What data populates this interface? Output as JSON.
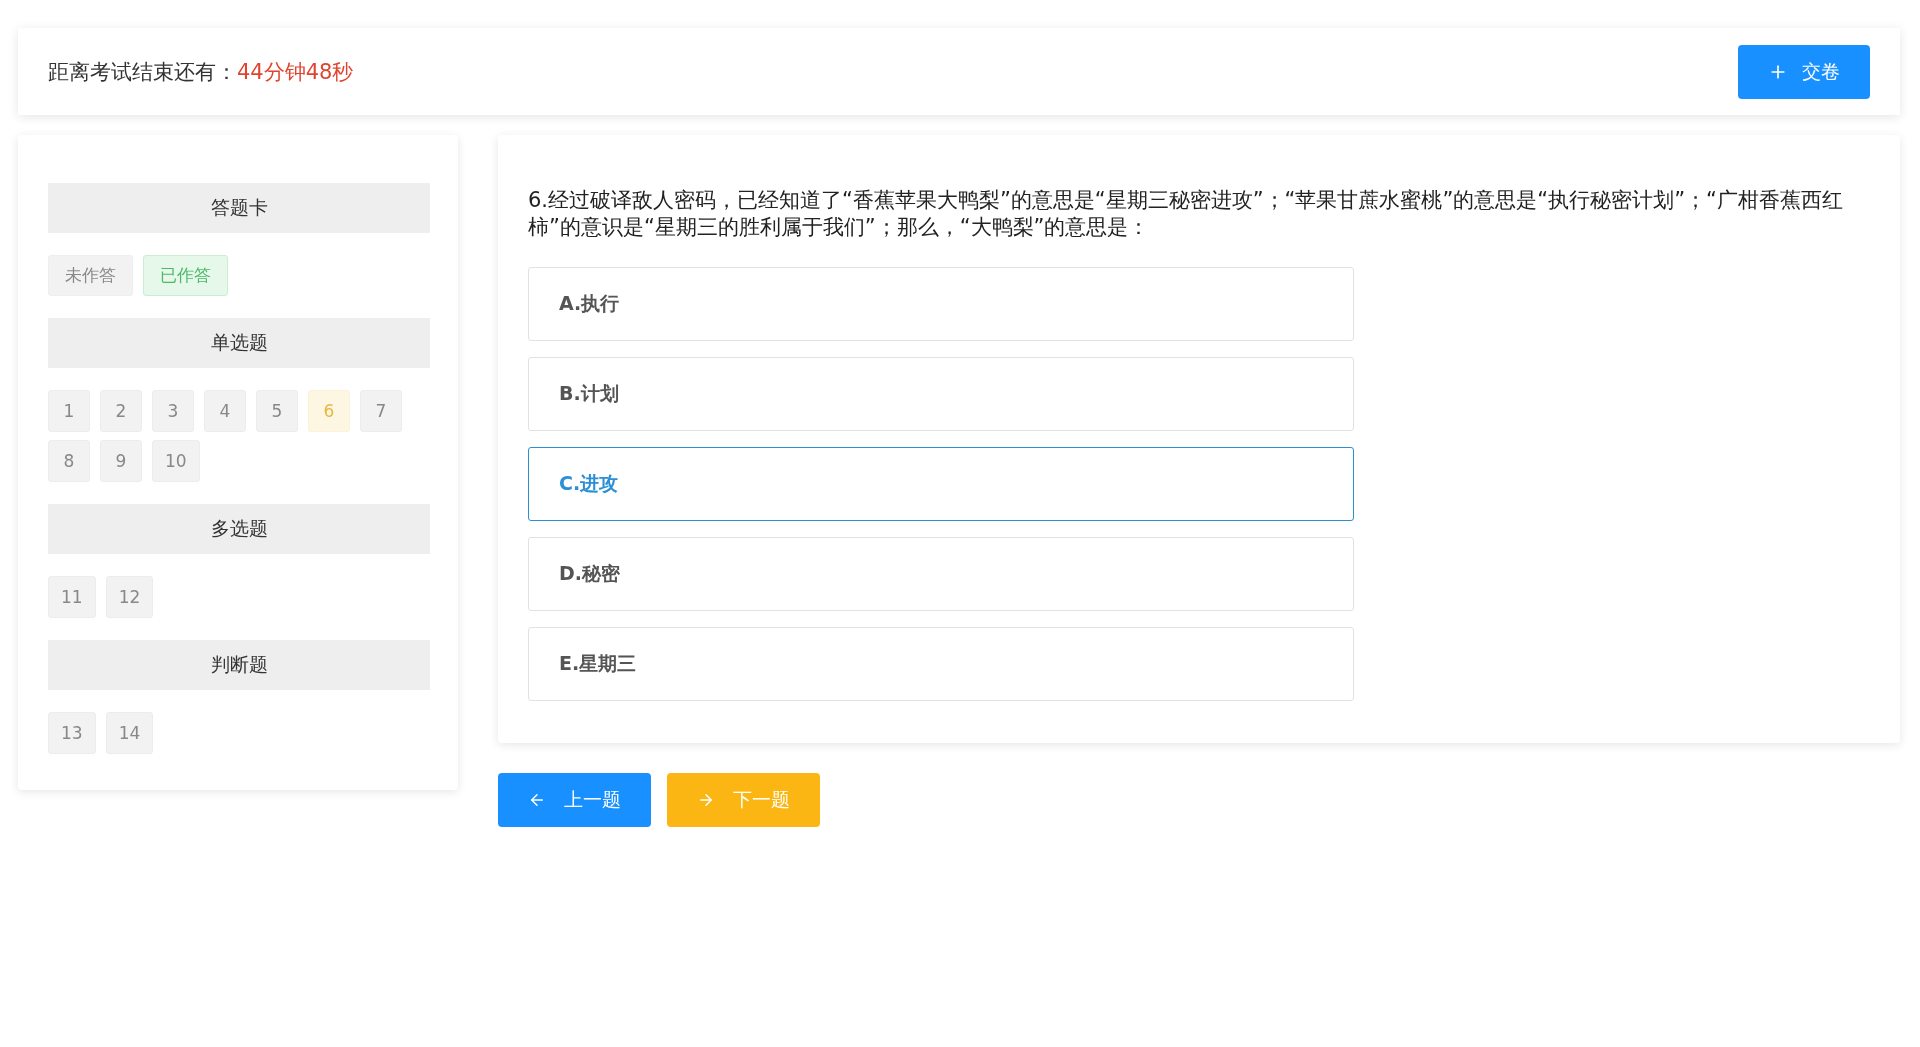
{
  "header": {
    "label": "距离考试结束还有：",
    "remaining": "44分钟48秒",
    "submit_button": "交卷"
  },
  "answer_card": {
    "title": "答题卡",
    "legend": [
      {
        "label": "未作答",
        "answered": false
      },
      {
        "label": "已作答",
        "answered": true
      }
    ],
    "sections": [
      {
        "title": "单选题",
        "questions": [
          {
            "number": "1",
            "selected": false
          },
          {
            "number": "2",
            "selected": false
          },
          {
            "number": "3",
            "selected": false
          },
          {
            "number": "4",
            "selected": false
          },
          {
            "number": "5",
            "selected": false
          },
          {
            "number": "6",
            "selected": true
          },
          {
            "number": "7",
            "selected": false
          },
          {
            "number": "8",
            "selected": false
          },
          {
            "number": "9",
            "selected": false
          },
          {
            "number": "10",
            "selected": false
          }
        ]
      },
      {
        "title": "多选题",
        "questions": [
          {
            "number": "11",
            "selected": false
          },
          {
            "number": "12",
            "selected": false
          }
        ]
      },
      {
        "title": "判断题",
        "questions": [
          {
            "number": "13",
            "selected": false
          },
          {
            "number": "14",
            "selected": false
          }
        ]
      }
    ]
  },
  "question": {
    "text": "6.经过破译敌人密码，已经知道了“香蕉苹果大鸭梨”的意思是“星期三秘密进攻”；“苹果甘蔗水蜜桃”的意思是“执行秘密计划”；“广柑香蕉西红柿”的意识是“星期三的胜利属于我们”；那么，“大鸭梨”的意思是：",
    "options": [
      {
        "label": "A.执行",
        "selected": false
      },
      {
        "label": "B.计划",
        "selected": false
      },
      {
        "label": "C.进攻",
        "selected": true
      },
      {
        "label": "D.秘密",
        "selected": false
      },
      {
        "label": "E.星期三",
        "selected": false
      }
    ]
  },
  "navigation": {
    "previous": "上一题",
    "next": "下一题"
  }
}
